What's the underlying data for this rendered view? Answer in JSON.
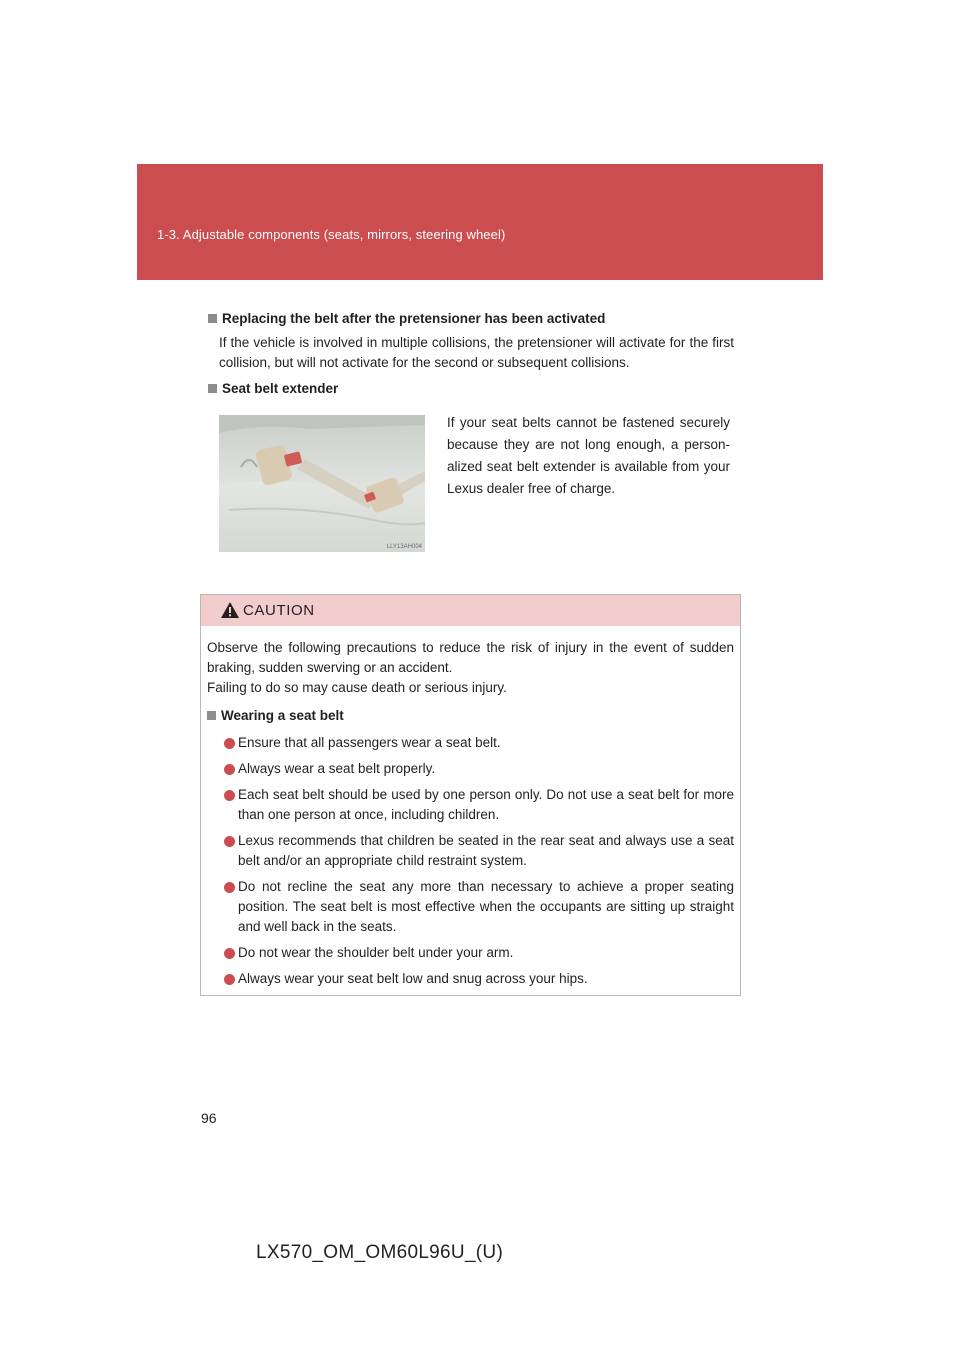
{
  "header": {
    "section_title": "1-3. Adjustable components (seats, mirrors, steering wheel)"
  },
  "replacing": {
    "title": "Replacing the belt after the pretensioner has been activated",
    "text": "If the vehicle is involved in multiple collisions, the pretensioner will activate for the first collision, but will not activate for the second or subsequent collisions."
  },
  "extender": {
    "title": "Seat belt extender",
    "text": "If your seat belts cannot be fastened securely because they are not long enough, a person­alized seat belt extender is available from your Lexus dealer free of charge.",
    "image_code": "LLY13AH004"
  },
  "caution": {
    "label": "CAUTION",
    "intro_1": "Observe the following precautions to reduce the risk of injury in the event of sudden braking, sudden swerving or an accident.",
    "intro_2": "Failing to do so may cause death or serious injury.",
    "subheading": "Wearing a seat belt",
    "bullets": [
      "Ensure that all passengers wear a seat belt.",
      "Always wear a seat belt properly.",
      "Each seat belt should be used by one person only. Do not use a seat belt for more than one person at once, including children.",
      "Lexus recommends that children be seated in the rear seat and always use a seat belt and/or an appropriate child restraint system.",
      "Do not recline the seat any more than necessary to achieve a proper seating position. The seat belt is most effective when the occupants are sitting up straight and well back in the seats.",
      "Do not wear the shoulder belt under your arm.",
      "Always wear your seat belt low and snug across your hips."
    ]
  },
  "footer": {
    "page_number": "96",
    "doc_code": "LX570_OM_OM60L96U_(U)"
  },
  "colors": {
    "header_red": "#cc4d4f",
    "caution_pink": "#f2cccd",
    "bullet_red": "#cc4d4f"
  }
}
